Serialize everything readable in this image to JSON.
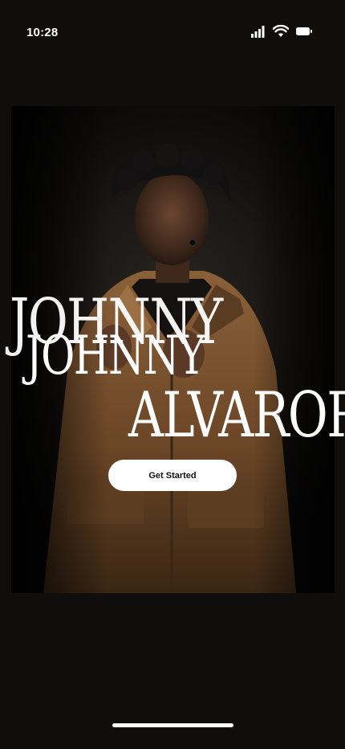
{
  "status_bar": {
    "time": "10:28",
    "icons": [
      "cellular-signal-icon",
      "wifi-icon",
      "battery-icon"
    ]
  },
  "hero": {
    "first_name_ghost": "JOHNNY",
    "first_name": "JOHNNY",
    "last_name": "ALVAROR"
  },
  "cta": {
    "label": "Get Started"
  },
  "colors": {
    "background": "#0f0e0d",
    "jacket": "#7a5531",
    "cta_background": "#ffffff",
    "cta_text": "#111111"
  }
}
